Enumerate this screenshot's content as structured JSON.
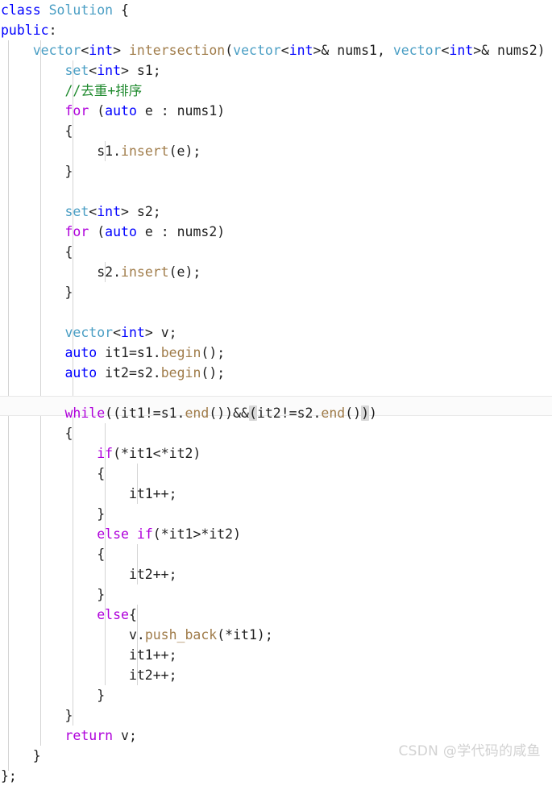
{
  "editor": {
    "language": "cpp",
    "background_color": "#ffffff",
    "font_size_px": 16.5,
    "line_height_px": 25,
    "current_line_number": 21,
    "current_line_highlight_color": "#fbfbfb",
    "indent_guide_color": "#d4d4d4",
    "bracket_match_highlight_color": "#d8d8d8",
    "colors": {
      "keyword": "#0000ff",
      "control": "#af00db",
      "type": "#4a9ec4",
      "function": "#a07c4a",
      "comment": "#1f8a2e",
      "plain": "#1f1f1f",
      "watermark": "#d2d2d2"
    },
    "indent_guides_x": [
      10,
      50,
      90,
      130,
      170
    ]
  },
  "code": {
    "lines": [
      "class Solution {",
      "public:",
      "    vector<int> intersection(vector<int>& nums1, vector<int>& nums2)",
      "        set<int> s1;",
      "        //去重+排序",
      "        for (auto e : nums1)",
      "        {",
      "            s1.insert(e);",
      "        }",
      "",
      "        set<int> s2;",
      "        for (auto e : nums2)",
      "        {",
      "            s2.insert(e);",
      "        }",
      "",
      "        vector<int> v;",
      "        auto it1=s1.begin();",
      "        auto it2=s2.begin();",
      "",
      "        while((it1!=s1.end())&&(it2!=s2.end()))",
      "        {",
      "            if(*it1<*it2)",
      "            {",
      "                it1++;",
      "            }",
      "            else if(*it1>*it2)",
      "            {",
      "                it2++;",
      "            }",
      "            else{",
      "                v.push_back(*it1);",
      "                it1++;",
      "                it2++;",
      "            }",
      "        }",
      "        return v;",
      "    }",
      "};"
    ]
  },
  "watermark": {
    "text": "CSDN @学代码的咸鱼"
  }
}
